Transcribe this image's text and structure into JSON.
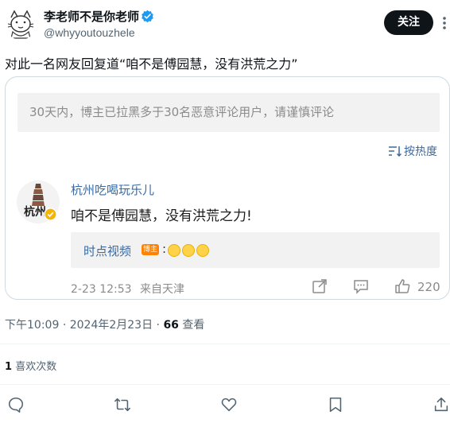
{
  "author": {
    "display_name": "李老师不是你老师",
    "handle": "@whyyoutouzhele",
    "follow_label": "关注"
  },
  "post": {
    "text": "对此一名网友回复道“咱不是傅园慧，没有洪荒之力”",
    "time": "下午10:09",
    "date": "2024年2月23日",
    "separator": "·",
    "views_count": "66",
    "views_label": "查看",
    "likes_count": "1",
    "likes_label": "喜欢次数"
  },
  "embed": {
    "notice": "30天内，博主已拉黑多于30名恶意评论用户，请谨慎评论",
    "sort_label": "按热度",
    "comment": {
      "username": "杭州吃喝玩乐儿",
      "avatar_text": "杭州",
      "text": "咱不是傅园慧，没有洪荒之力!",
      "reply_username": "时点视频",
      "reply_tag": "博主",
      "reply_colon": ":",
      "time": "2-23 12:53",
      "source": "来自天津",
      "like_count": "220"
    }
  },
  "icons": [
    "cat-avatar-icon",
    "verified-badge-icon",
    "more-icon",
    "sort-icon",
    "share-icon",
    "comment-icon",
    "like-icon",
    "reply-icon",
    "retweet-icon",
    "heart-icon",
    "bookmark-icon",
    "upload-icon"
  ],
  "colors": {
    "follow_bg": "#0f1419",
    "link": "#3b6aa0",
    "verified": "#1d9bf0",
    "muted": "#536471"
  }
}
